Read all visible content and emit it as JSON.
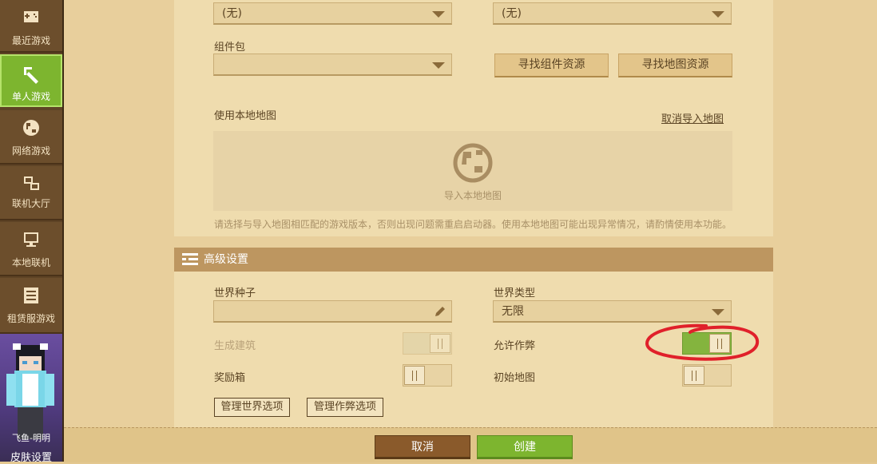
{
  "sidebar": {
    "items": [
      {
        "label": "最近游戏",
        "icon": "gamepad-icon"
      },
      {
        "label": "单人游戏",
        "icon": "pickaxe-icon",
        "active": true
      },
      {
        "label": "网络游戏",
        "icon": "globe-icon"
      },
      {
        "label": "联机大厅",
        "icon": "network-icon"
      },
      {
        "label": "本地联机",
        "icon": "monitor-icon"
      },
      {
        "label": "租赁服游戏",
        "icon": "server-list-icon"
      }
    ],
    "skin": {
      "name": "飞鱼-明明",
      "settings_label": "皮肤设置"
    }
  },
  "resources": {
    "behavior_pack_value": "(无)",
    "resource_pack_value": "(无)",
    "component_pack_label": "组件包",
    "component_pack_value": "",
    "find_component_button": "寻找组件资源",
    "find_map_button": "寻找地图资源"
  },
  "local_map": {
    "label": "使用本地地图",
    "cancel_import": "取消导入地图",
    "import_label": "导入本地地图",
    "notice": "请选择与导入地图相匹配的游戏版本，否则出现问题需重启启动器。使用本地地图可能出现异常情况，请酌情使用本功能。"
  },
  "advanced": {
    "header": "高级设置",
    "seed_label": "世界种子",
    "seed_value": "",
    "world_type_label": "世界类型",
    "world_type_value": "无限",
    "generate_structures_label": "生成建筑",
    "generate_structures": false,
    "allow_cheats_label": "允许作弊",
    "allow_cheats": true,
    "bonus_chest_label": "奖励箱",
    "bonus_chest": false,
    "starting_map_label": "初始地图",
    "starting_map": false,
    "manage_world_options": "管理世界选项",
    "manage_cheat_options": "管理作弊选项"
  },
  "actions": {
    "cancel": "取消",
    "create": "创建"
  },
  "colors": {
    "accent_green": "#7db52f",
    "cancel_brown": "#8a5a2b",
    "highlight_red": "#e0202a"
  }
}
